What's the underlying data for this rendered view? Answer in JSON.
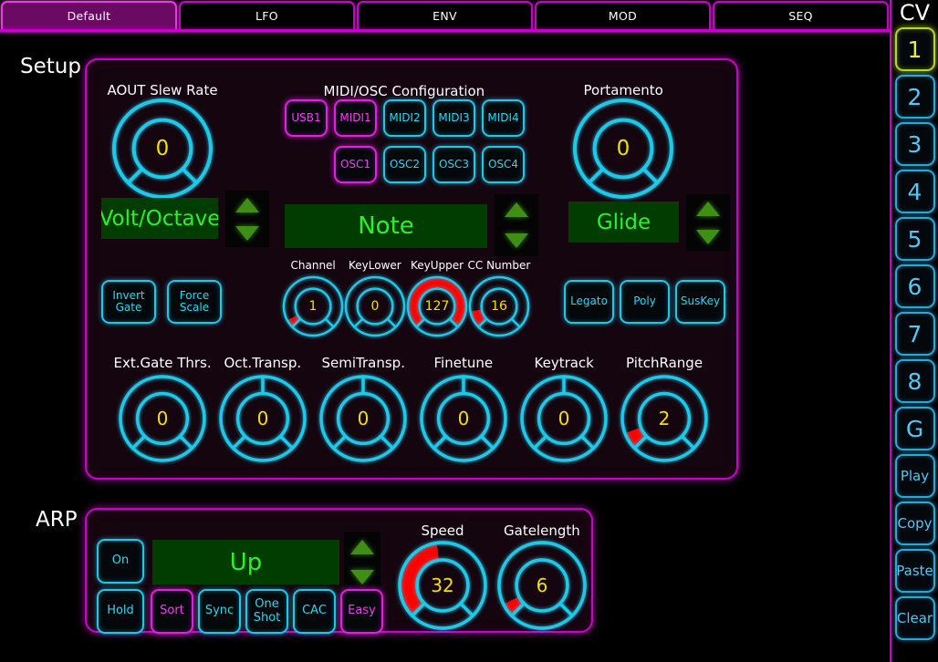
{
  "tabs": [
    {
      "label": "Default",
      "active": true
    },
    {
      "label": "LFO",
      "active": false
    },
    {
      "label": "ENV",
      "active": false
    },
    {
      "label": "MOD",
      "active": false
    },
    {
      "label": "SEQ",
      "active": false
    }
  ],
  "sidebar": {
    "title": "CV",
    "items": [
      {
        "label": "1",
        "kind": "num",
        "selected": true
      },
      {
        "label": "2",
        "kind": "num",
        "selected": false
      },
      {
        "label": "3",
        "kind": "num",
        "selected": false
      },
      {
        "label": "4",
        "kind": "num",
        "selected": false
      },
      {
        "label": "5",
        "kind": "num",
        "selected": false
      },
      {
        "label": "6",
        "kind": "num",
        "selected": false
      },
      {
        "label": "7",
        "kind": "num",
        "selected": false
      },
      {
        "label": "8",
        "kind": "num",
        "selected": false
      },
      {
        "label": "G",
        "kind": "num",
        "selected": false
      },
      {
        "label": "Play",
        "kind": "word",
        "selected": false
      },
      {
        "label": "Copy",
        "kind": "word",
        "selected": false
      },
      {
        "label": "Paste",
        "kind": "word",
        "selected": false
      },
      {
        "label": "Clear",
        "kind": "word",
        "selected": false
      }
    ]
  },
  "setup": {
    "section_label": "Setup",
    "aout": {
      "title": "AOUT Slew Rate",
      "knob": {
        "value": "0",
        "pct": 0,
        "bipolar": false
      },
      "mode": "Volt/Octave"
    },
    "midi_osc": {
      "title": "MIDI/OSC Configuration",
      "row1": [
        {
          "label": "USB1",
          "on": true
        },
        {
          "label": "MIDI1",
          "on": true
        },
        {
          "label": "MIDI2",
          "on": false
        },
        {
          "label": "MIDI3",
          "on": false
        },
        {
          "label": "MIDI4",
          "on": false
        }
      ],
      "row2": [
        {
          "label": "OSC1",
          "on": true
        },
        {
          "label": "OSC2",
          "on": false
        },
        {
          "label": "OSC3",
          "on": false
        },
        {
          "label": "OSC4",
          "on": false
        }
      ],
      "event": "Note",
      "small_knobs": [
        {
          "title": "Channel",
          "value": "1",
          "pct": 6,
          "bipolar": false
        },
        {
          "title": "KeyLower",
          "value": "0",
          "pct": 0,
          "bipolar": false
        },
        {
          "title": "KeyUpper",
          "value": "127",
          "pct": 100,
          "bipolar": false
        },
        {
          "title": "CC Number",
          "value": "16",
          "pct": 13,
          "bipolar": false
        }
      ]
    },
    "portamento": {
      "title": "Portamento",
      "knob": {
        "value": "0",
        "pct": 0,
        "bipolar": false
      },
      "mode": "Glide"
    },
    "left_buttons": [
      {
        "label": "Invert\nGate",
        "on": false
      },
      {
        "label": "Force\nScale",
        "on": false
      }
    ],
    "right_buttons": [
      {
        "label": "Legato",
        "on": false
      },
      {
        "label": "Poly",
        "on": false
      },
      {
        "label": "SusKey",
        "on": false
      }
    ],
    "bottom_knobs": [
      {
        "title": "Ext.Gate Thrs.",
        "value": "0",
        "pct": 0,
        "bipolar": false
      },
      {
        "title": "Oct.Transp.",
        "value": "0",
        "pct": 0,
        "bipolar": true
      },
      {
        "title": "SemiTransp.",
        "value": "0",
        "pct": 0,
        "bipolar": true
      },
      {
        "title": "Finetune",
        "value": "0",
        "pct": 0,
        "bipolar": true
      },
      {
        "title": "Keytrack",
        "value": "0",
        "pct": 0,
        "bipolar": true
      },
      {
        "title": "PitchRange",
        "value": "2",
        "pct": 9,
        "bipolar": false
      }
    ]
  },
  "arp": {
    "section_label": "ARP",
    "on_button": {
      "label": "On",
      "on": false
    },
    "hold_button": {
      "label": "Hold",
      "on": false
    },
    "mode": "Up",
    "mode_buttons": [
      {
        "label": "Sort",
        "on": true
      },
      {
        "label": "Sync",
        "on": false
      },
      {
        "label": "One\nShot",
        "on": false
      },
      {
        "label": "CAC",
        "on": false
      },
      {
        "label": "Easy",
        "on": true
      }
    ],
    "knobs": [
      {
        "title": "Speed",
        "value": "32",
        "pct": 47,
        "bipolar": false
      },
      {
        "title": "Gatelength",
        "value": "6",
        "pct": 7,
        "bipolar": false
      }
    ]
  },
  "colors": {
    "accent_magenta": "#cc00cc",
    "accent_cyan": "#1ec8e8",
    "value_yellow": "#f2e000",
    "lcd_green": "#2bf02b",
    "fill_red": "#ff0000",
    "selected_yellow": "#b9d81f"
  }
}
